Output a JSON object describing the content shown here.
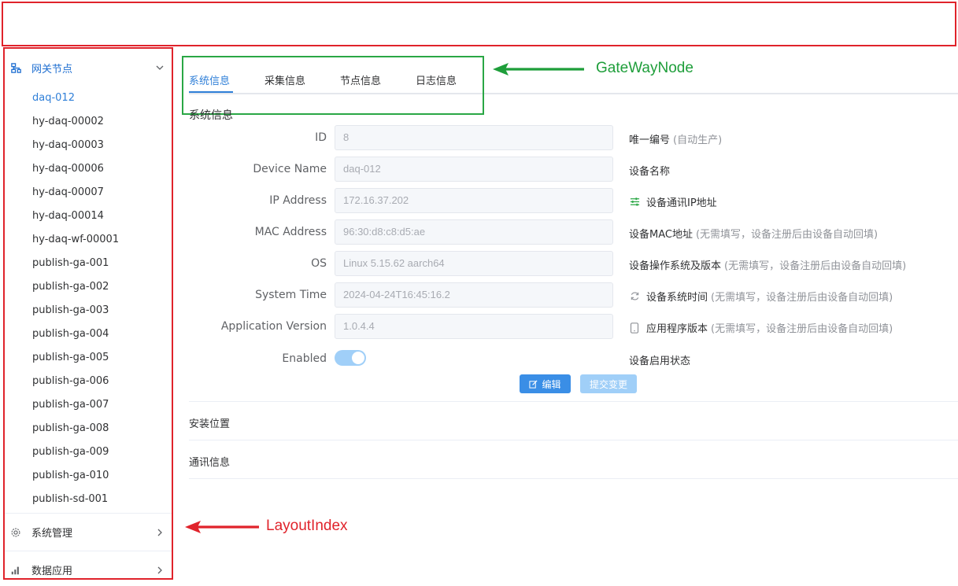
{
  "sidebar": {
    "group_label": "网关节点",
    "nodes": [
      "daq-012",
      "hy-daq-00002",
      "hy-daq-00003",
      "hy-daq-00006",
      "hy-daq-00007",
      "hy-daq-00014",
      "hy-daq-wf-00001",
      "publish-ga-001",
      "publish-ga-002",
      "publish-ga-003",
      "publish-ga-004",
      "publish-ga-005",
      "publish-ga-006",
      "publish-ga-007",
      "publish-ga-008",
      "publish-ga-009",
      "publish-ga-010",
      "publish-sd-001"
    ],
    "active_node": "daq-012",
    "system_mgmt_label": "系统管理",
    "data_app_label": "数据应用"
  },
  "tabs": [
    "系统信息",
    "采集信息",
    "节点信息",
    "日志信息"
  ],
  "active_tab": "系统信息",
  "section_title": "系统信息",
  "form": {
    "id": {
      "label": "ID",
      "value": "8",
      "desc": "唯一编号",
      "hint": "(自动生产)"
    },
    "device_name": {
      "label": "Device Name",
      "value": "daq-012",
      "desc": "设备名称",
      "hint": ""
    },
    "ip_address": {
      "label": "IP Address",
      "value": "172.16.37.202",
      "desc": "设备通讯IP地址",
      "hint": ""
    },
    "mac_address": {
      "label": "MAC Address",
      "value": "96:30:d8:c8:d5:ae",
      "desc": "设备MAC地址",
      "hint": "(无需填写，设备注册后由设备自动回填)"
    },
    "os": {
      "label": "OS",
      "value": "Linux 5.15.62 aarch64",
      "desc": "设备操作系统及版本",
      "hint": "(无需填写，设备注册后由设备自动回填)"
    },
    "system_time": {
      "label": "System Time",
      "value": "2024-04-24T16:45:16.2",
      "desc": "设备系统时间",
      "hint": "(无需填写，设备注册后由设备自动回填)"
    },
    "app_version": {
      "label": "Application Version",
      "value": "1.0.4.4",
      "desc": "应用程序版本",
      "hint": "(无需填写，设备注册后由设备自动回填)"
    },
    "enabled": {
      "label": "Enabled",
      "value": true,
      "desc": "设备启用状态"
    }
  },
  "buttons": {
    "edit": "编辑",
    "submit": "提交变更"
  },
  "collapse": {
    "install_location": "安装位置",
    "comm_info": "通讯信息"
  },
  "annotations": {
    "green_label": "GateWayNode",
    "red_label": "LayoutIndex"
  },
  "colors": {
    "accent": "#2f7fd8",
    "annotation_red": "#e0232b",
    "annotation_green": "#1e9e3a"
  }
}
